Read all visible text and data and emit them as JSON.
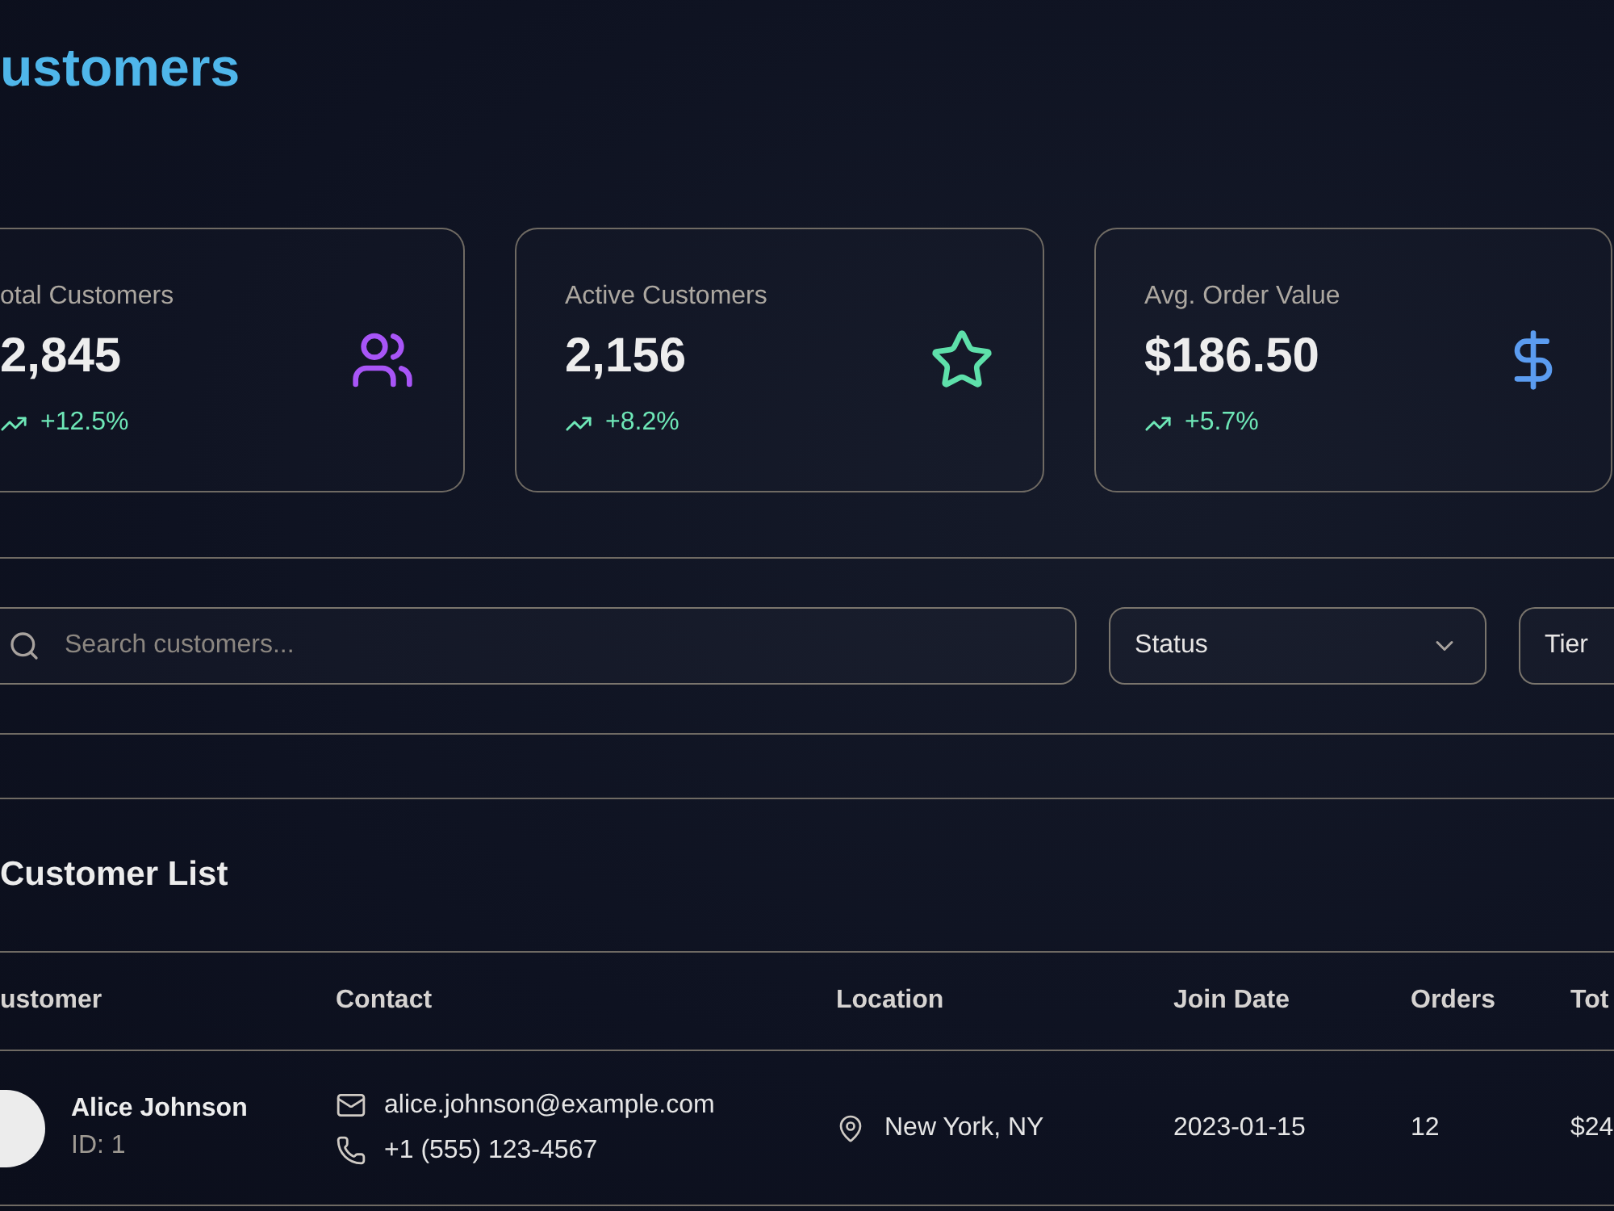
{
  "page": {
    "title": "ustomers"
  },
  "stats": [
    {
      "kind": "count",
      "label": "otal Customers",
      "value": "2,845",
      "change": "+12.5%",
      "clipped": true
    },
    {
      "kind": "active",
      "label": "Active Customers",
      "value": "2,156",
      "change": "+8.2%",
      "clipped": false
    },
    {
      "kind": "currency",
      "label": "Avg. Order Value",
      "value": "$186.50",
      "change": "+5.7%",
      "clipped": false
    }
  ],
  "filters": {
    "search": {
      "placeholder": "Search customers...",
      "clipped": true
    },
    "selects": [
      {
        "label": "Status",
        "clipped": false
      },
      {
        "label": "Tier",
        "clipped": true
      }
    ]
  },
  "table": {
    "title": "Customer List",
    "columns": [
      "ustomer",
      "Contact",
      "Location",
      "Join Date",
      "Orders",
      "Tot"
    ],
    "rows": [
      {
        "name": "Alice Johnson",
        "id": "ID: 1",
        "email": "alice.johnson@example.com",
        "phone": "+1 (555) 123-4567",
        "location": "New York, NY",
        "join_date": "2023-01-15",
        "orders": "12",
        "total": "$24"
      }
    ]
  }
}
